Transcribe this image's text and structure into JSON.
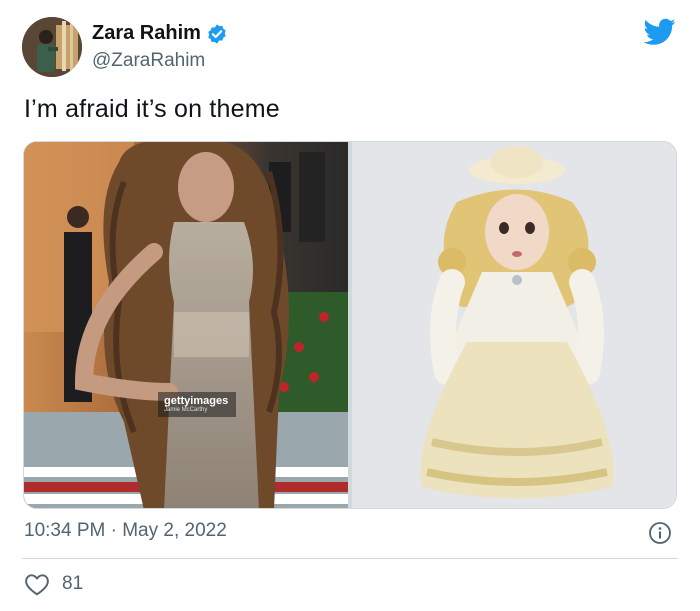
{
  "author": {
    "name": "Zara Rahim",
    "handle": "@ZaraRahim",
    "verified": true,
    "avatar_icon": "profile-photo"
  },
  "brand": {
    "logo_icon": "twitter-bird-icon",
    "accent_color": "#1d9bf0"
  },
  "tweet": {
    "text": "I’m afraid it’s on theme",
    "media": [
      {
        "description_icon": "photo-gala-dress",
        "watermark_logo": "gettyimages",
        "watermark_credit": "Jamie McCarthy"
      },
      {
        "description_icon": "photo-porcelain-doll"
      }
    ],
    "time": "10:34 PM",
    "separator": "·",
    "date": "May 2, 2022"
  },
  "engagement": {
    "likes": "81"
  }
}
